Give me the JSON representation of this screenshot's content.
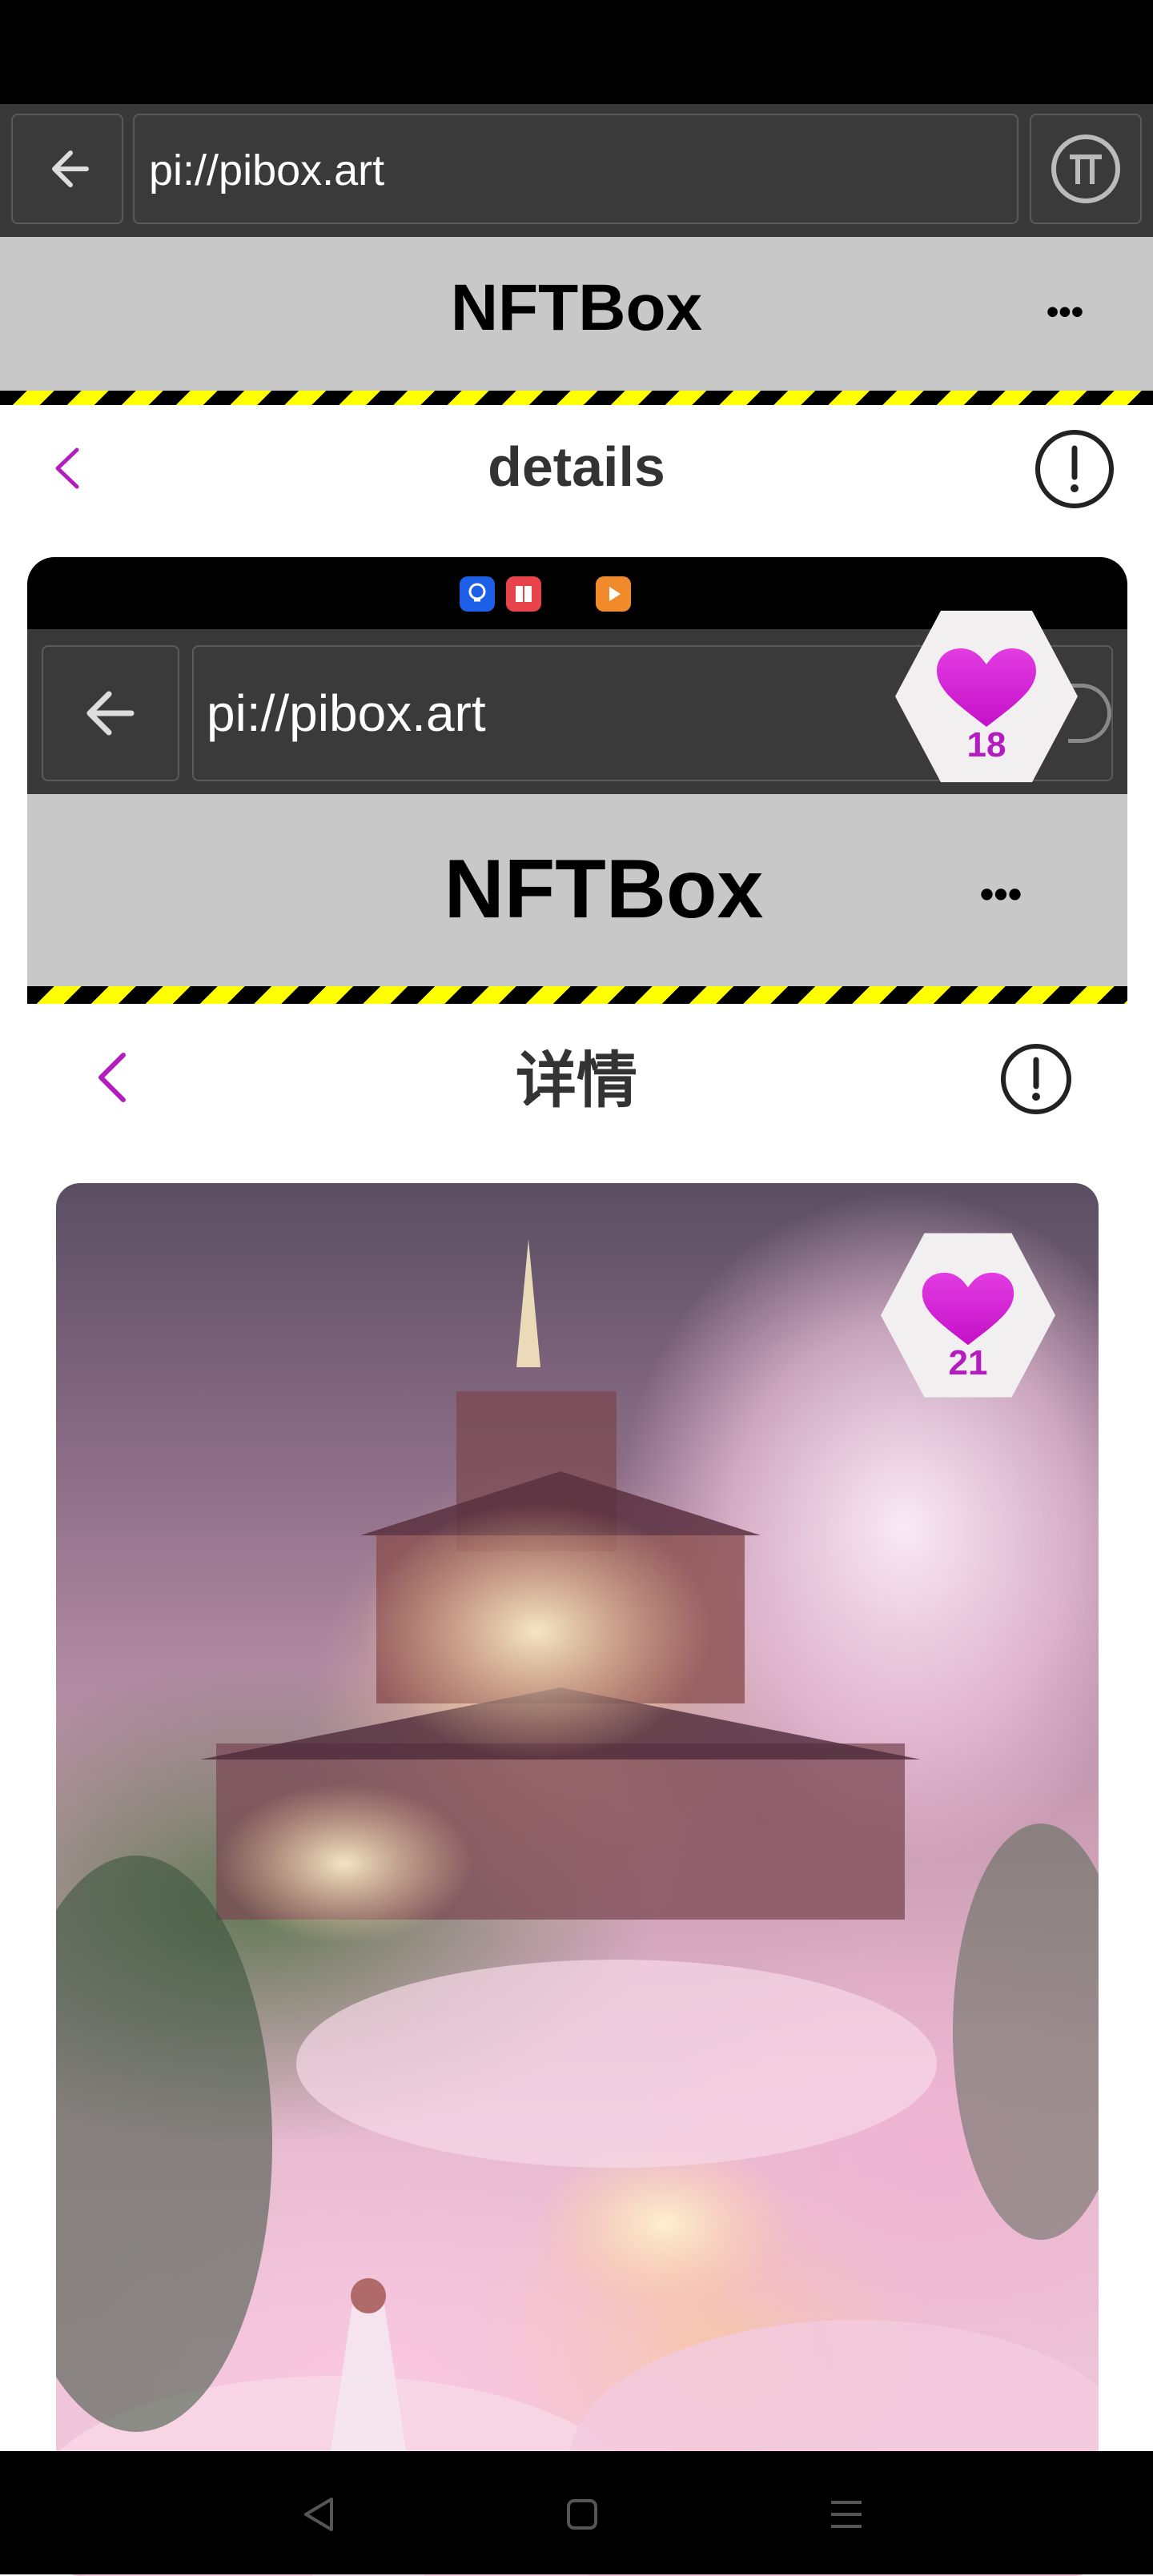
{
  "browser": {
    "url": "pi://pibox.art"
  },
  "app": {
    "title": "NFTBox",
    "more": "•••"
  },
  "page": {
    "title": "details"
  },
  "embedded": {
    "url": "pi://pibox.art",
    "app_title": "NFTBox",
    "more": "•••",
    "page_title": "详情",
    "overlay_likes": "18",
    "art_likes": "21"
  },
  "colors": {
    "accent": "#b41cc0",
    "heart": "#d41fd4",
    "stripe_yellow": "#ffff00"
  }
}
